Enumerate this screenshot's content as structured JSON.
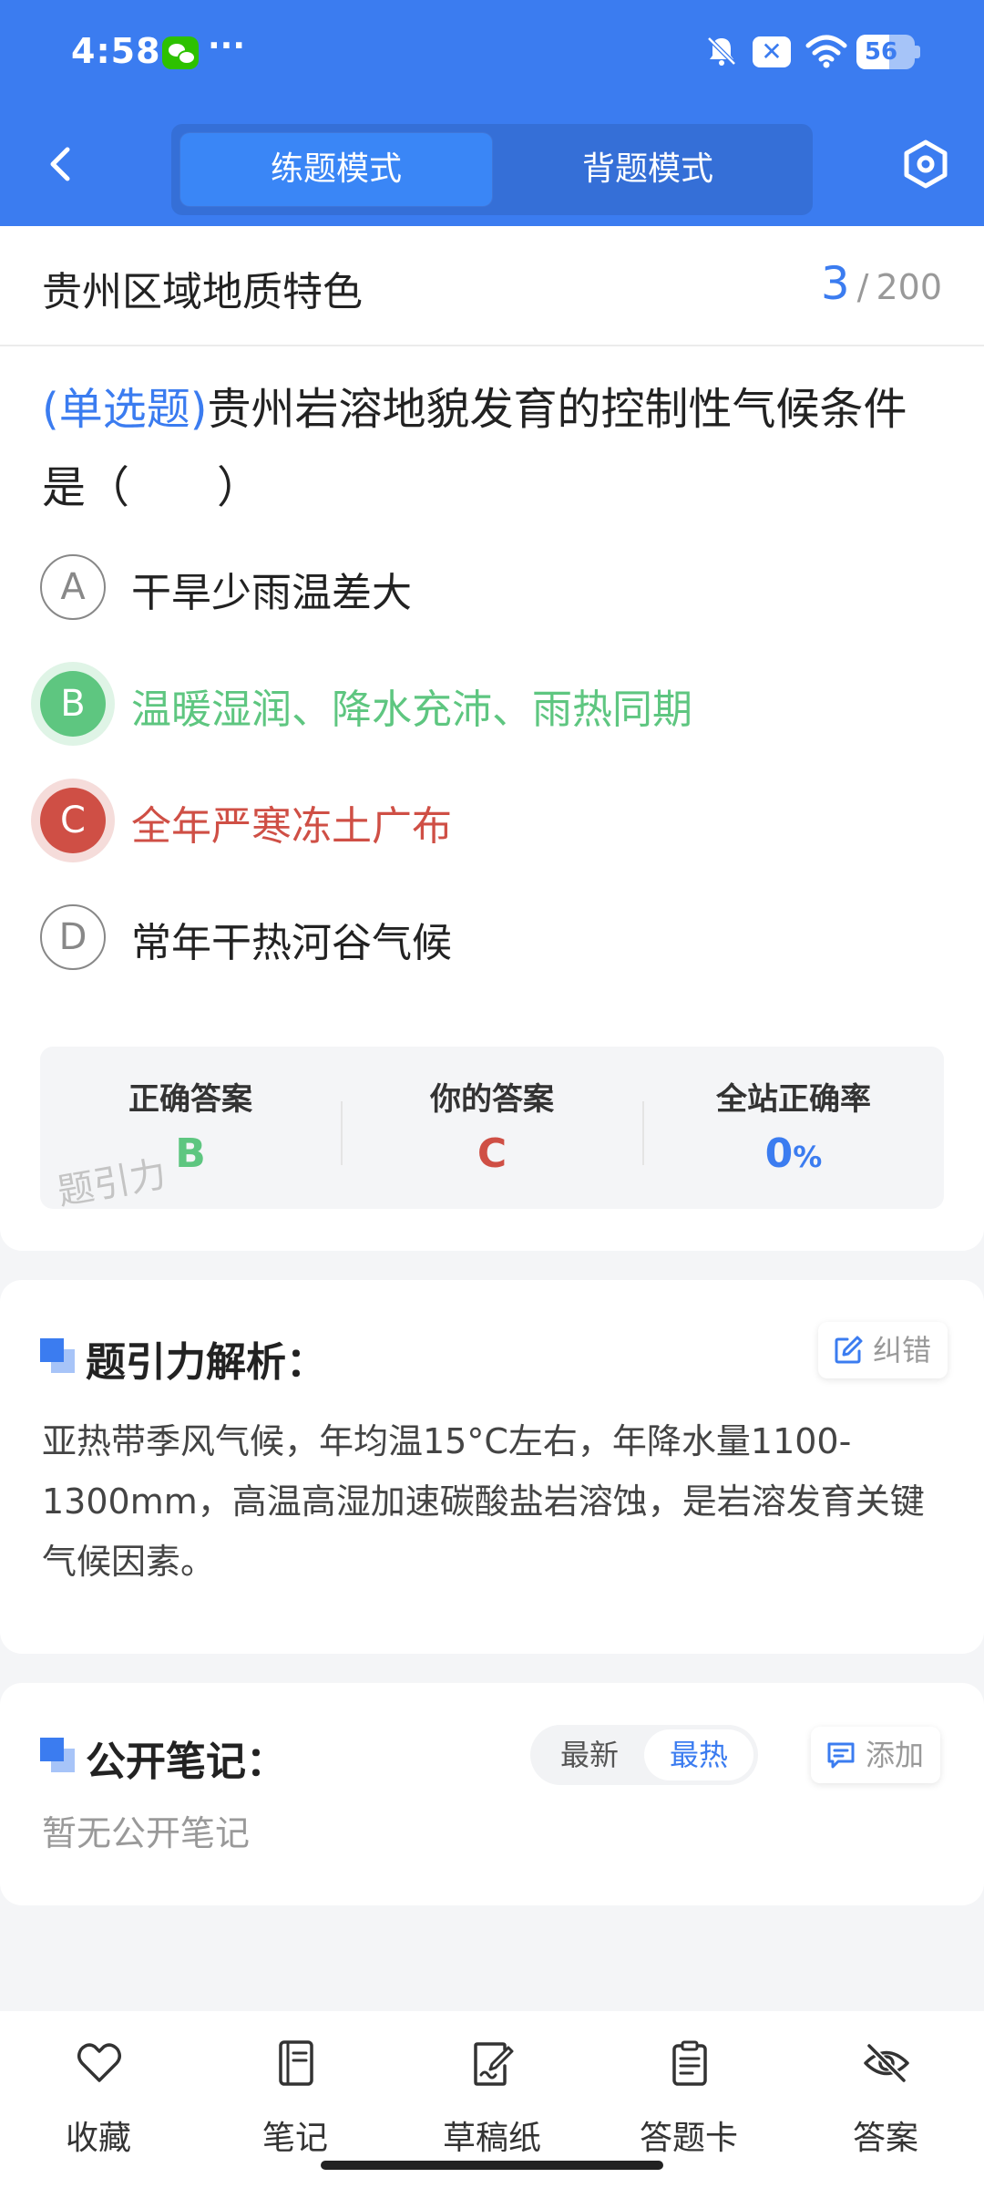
{
  "status_bar": {
    "time": "4:58",
    "more": "···",
    "battery": "56",
    "battery_level": 0.56
  },
  "nav": {
    "tab_practice": "练题模式",
    "tab_memorize": "背题模式",
    "active_tab": "practice"
  },
  "question": {
    "topic": "贵州区域地质特色",
    "current": "3",
    "separator": "/",
    "total": "200",
    "type": "(单选题)",
    "stem": "贵州岩溶地貌发育的控制性气候条件是（　　）",
    "options": [
      {
        "letter": "A",
        "text": "干旱少雨温差大",
        "state": "normal"
      },
      {
        "letter": "B",
        "text": "温暖湿润、降水充沛、雨热同期",
        "state": "correct"
      },
      {
        "letter": "C",
        "text": "全年严寒冻土广布",
        "state": "wrong"
      },
      {
        "letter": "D",
        "text": "常年干热河谷气候",
        "state": "normal"
      }
    ]
  },
  "result": {
    "correct_label": "正确答案",
    "correct_value": "B",
    "yours_label": "你的答案",
    "yours_value": "C",
    "rate_label": "全站正确率",
    "rate_value": "0",
    "rate_unit": "%",
    "watermark": "题引力"
  },
  "analysis": {
    "title": "题引力解析：",
    "report_btn": "纠错",
    "text": "亚热带季风气候，年均温15°C左右，年降水量1100-1300mm，高温高湿加速碳酸盐岩溶蚀，是岩溶发育关键气候因素。"
  },
  "notes": {
    "title": "公开笔记：",
    "sort_newest": "最新",
    "sort_hottest": "最热",
    "active_sort": "hottest",
    "add_btn": "添加",
    "empty": "暂无公开笔记"
  },
  "toolbar": {
    "favorite": "收藏",
    "notes": "笔记",
    "draft": "草稿纸",
    "answer_card": "答题卡",
    "answer": "答案"
  },
  "colors": {
    "primary": "#3b7cf0",
    "correct": "#5ec680",
    "wrong": "#cf4f45"
  }
}
